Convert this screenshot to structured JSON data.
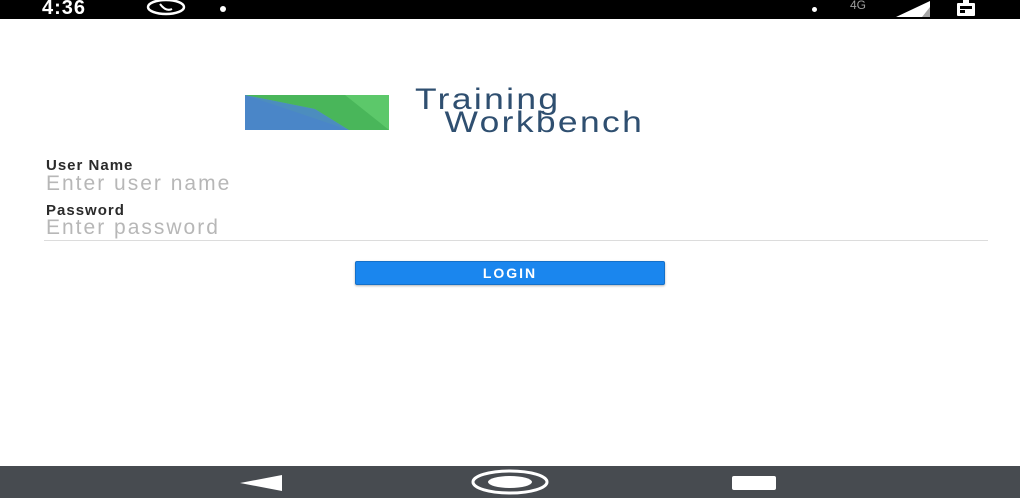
{
  "status_bar": {
    "time": "4:36",
    "network": "4G",
    "icons": [
      "whatsapp-icon",
      "notification-dot-icon",
      "signal-icon",
      "battery-icon"
    ]
  },
  "logo": {
    "line1": "Training",
    "line2": "Workbench",
    "colors": {
      "blue": "#4a86c8",
      "green": "#5cc86a",
      "dark_green": "#3aa84c",
      "text": "#2f4f70"
    }
  },
  "form": {
    "username_label": "User Name",
    "username_placeholder": "Enter user name",
    "username_value": "",
    "password_label": "Password",
    "password_placeholder": "Enter password",
    "password_value": ""
  },
  "login_button": {
    "label": "LOGIN",
    "color": "#1a86ee"
  },
  "nav_bar": {
    "items": [
      "back-icon",
      "home-icon",
      "recents-icon"
    ],
    "color": "#474b50"
  }
}
